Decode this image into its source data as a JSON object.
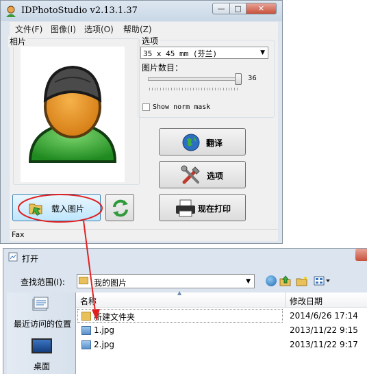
{
  "main_window": {
    "title": "IDPhotoStudio v2.13.1.37",
    "caption_buttons": {
      "minimize": "—",
      "maximize": "□",
      "close": "✕"
    },
    "menu": [
      "文件(F)",
      "图像(I)",
      "选项(O)",
      "帮助(Z)"
    ],
    "photo_group_label": "相片",
    "options_group_label": "选项",
    "size_select": "35 x 45 mm (芬兰)",
    "count_label": "图片数目：",
    "count_value": "36",
    "count_slider_fraction": 1.0,
    "show_norm_mask": "Show norm mask",
    "buttons": {
      "translate": "翻译",
      "options": "选项",
      "print": "现在打印",
      "load": "载入图片"
    },
    "status": "Fax"
  },
  "open_dialog": {
    "title": "打开",
    "look_in_label": "查找范围(I):",
    "look_in_value": "我的图片",
    "places": [
      "最近访问的位置",
      "桌面"
    ],
    "columns": {
      "name": "名称",
      "date": "修改日期"
    },
    "files": [
      {
        "name": "新建文件夹",
        "date": "2014/6/26 17:14",
        "type": "folder"
      },
      {
        "name": "1.jpg",
        "date": "2013/11/22 9:15",
        "type": "jpg"
      },
      {
        "name": "2.jpg",
        "date": "2013/11/22 9:17",
        "type": "jpg"
      }
    ]
  },
  "colors": {
    "annotation": "#e02020",
    "title_bar": "#c9d7e6",
    "selection": "#bee6fd"
  }
}
